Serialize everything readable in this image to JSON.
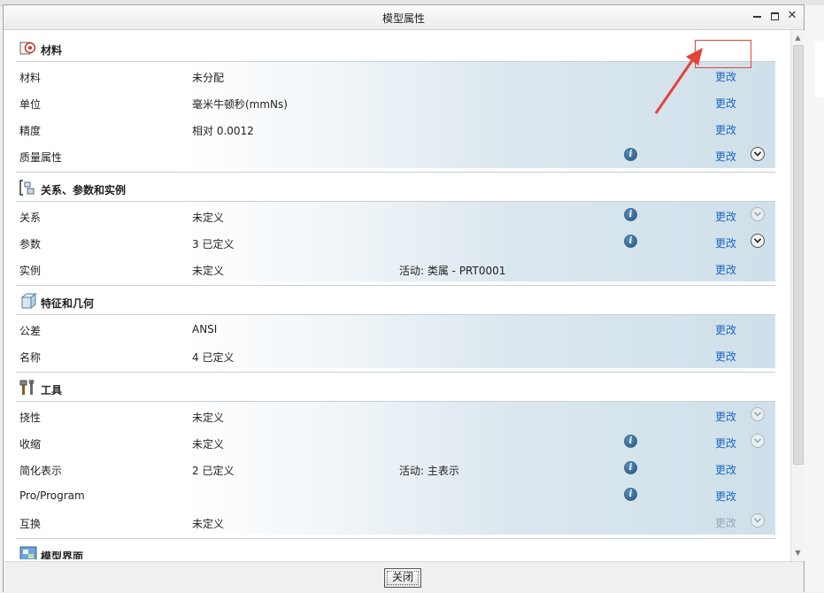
{
  "window": {
    "title": "模型属性"
  },
  "change_label": "更改",
  "sections": [
    {
      "title": "材料",
      "icon": "material-icon",
      "rows": [
        {
          "label": "材料",
          "value": "未分配",
          "extra": "",
          "info": false,
          "change_dim": false,
          "expand": "none"
        },
        {
          "label": "单位",
          "value": "毫米牛顿秒(mmNs)",
          "extra": "",
          "info": false,
          "change_dim": false,
          "expand": "none"
        },
        {
          "label": "精度",
          "value": "相对 0.0012",
          "extra": "",
          "info": false,
          "change_dim": false,
          "expand": "none"
        },
        {
          "label": "质量属性",
          "value": "",
          "extra": "",
          "info": true,
          "change_dim": false,
          "expand": "active"
        }
      ]
    },
    {
      "title": "关系、参数和实例",
      "icon": "relations-icon",
      "rows": [
        {
          "label": "关系",
          "value": "未定义",
          "extra": "",
          "info": true,
          "change_dim": false,
          "expand": "dim"
        },
        {
          "label": "参数",
          "value": "3 已定义",
          "extra": "",
          "info": true,
          "change_dim": false,
          "expand": "active"
        },
        {
          "label": "实例",
          "value": "未定义",
          "extra": "活动: 类属 - PRT0001",
          "info": false,
          "change_dim": false,
          "expand": "none"
        }
      ]
    },
    {
      "title": "特征和几何",
      "icon": "feature-geometry-icon",
      "rows": [
        {
          "label": "公差",
          "value": "ANSI",
          "extra": "",
          "info": false,
          "change_dim": false,
          "expand": "none"
        },
        {
          "label": "名称",
          "value": "4 已定义",
          "extra": "",
          "info": false,
          "change_dim": false,
          "expand": "none"
        }
      ]
    },
    {
      "title": "工具",
      "icon": "tools-icon",
      "rows": [
        {
          "label": "挠性",
          "value": "未定义",
          "extra": "",
          "info": false,
          "change_dim": false,
          "expand": "dim"
        },
        {
          "label": "收缩",
          "value": "未定义",
          "extra": "",
          "info": true,
          "change_dim": false,
          "expand": "dim"
        },
        {
          "label": "简化表示",
          "value": "2 已定义",
          "extra": "活动: 主表示",
          "info": true,
          "change_dim": false,
          "expand": "none"
        },
        {
          "label": "Pro/Program",
          "value": "",
          "extra": "",
          "info": true,
          "change_dim": false,
          "expand": "none"
        },
        {
          "label": "互换",
          "value": "未定义",
          "extra": "",
          "info": false,
          "change_dim": true,
          "expand": "dim"
        }
      ]
    },
    {
      "title": "模型界面",
      "icon": "model-interface-icon",
      "rows": []
    }
  ],
  "footer": {
    "close_label": "关闭"
  },
  "colors": {
    "link": "#1b67c4",
    "highlight": "#e3443a",
    "row_gradient_end": "#cfe0ea"
  }
}
